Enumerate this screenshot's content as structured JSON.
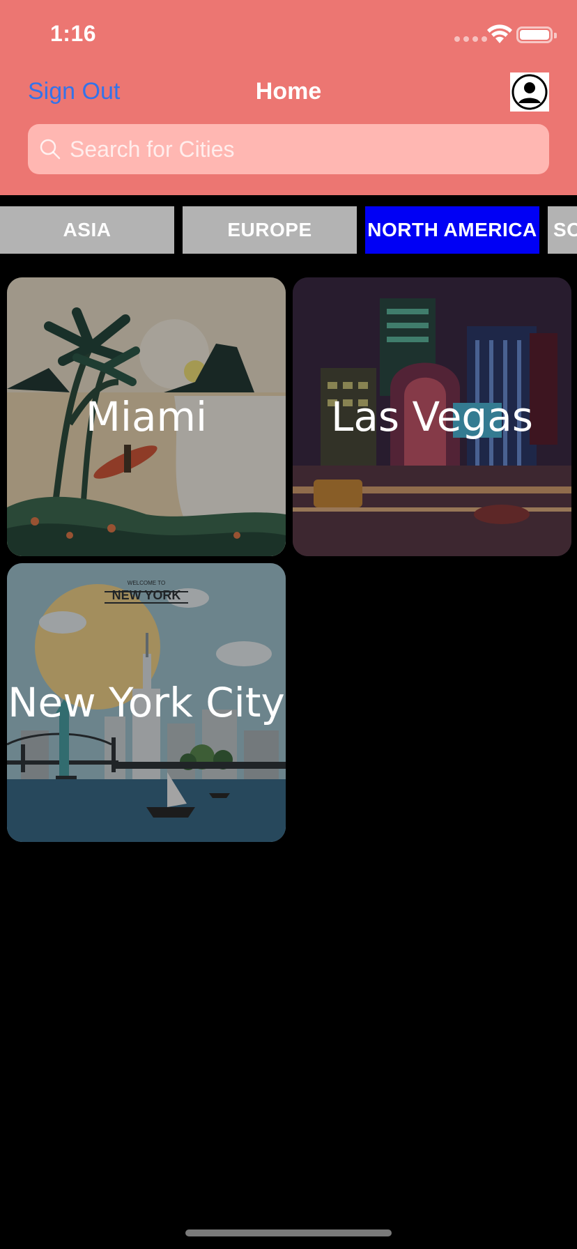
{
  "status_bar": {
    "time": "1:16"
  },
  "nav": {
    "sign_out_label": "Sign Out",
    "title": "Home"
  },
  "search": {
    "placeholder": "Search for Cities"
  },
  "regions": [
    {
      "label": "ASIA",
      "active": false
    },
    {
      "label": "EUROPE",
      "active": false
    },
    {
      "label": "NORTH AMERICA",
      "active": true
    },
    {
      "label": "SO",
      "active": false
    }
  ],
  "cities": [
    {
      "name": "Miami"
    },
    {
      "name": "Las Vegas"
    },
    {
      "name": "New York City",
      "poster_heading": "WELCOME TO",
      "poster_title": "NEW YORK"
    }
  ],
  "colors": {
    "header_bg": "#ec7672",
    "search_bg": "#ffb7b2",
    "link_blue": "#3373ea",
    "tab_inactive": "#b3b3b3",
    "tab_active": "#0000f5",
    "background": "#000000"
  }
}
